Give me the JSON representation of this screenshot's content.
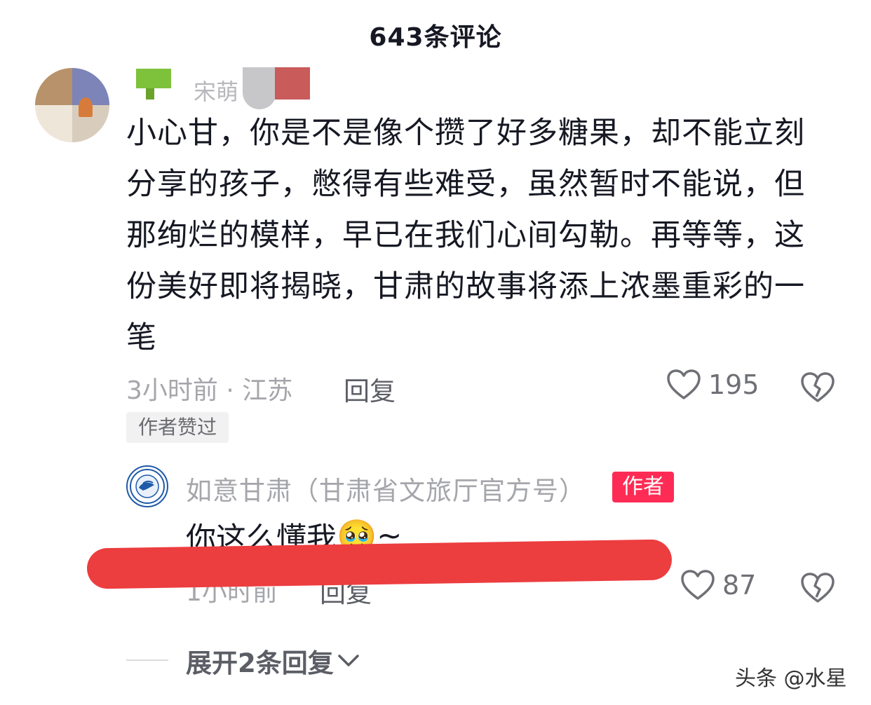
{
  "header": {
    "title": "643条评论"
  },
  "main_comment": {
    "username": "宋萌",
    "lines": [
      "小心甘，你是不是像个攒了好多糖果，却不能立刻",
      "分享的孩子，憋得有些难受，虽然暂时不能说，但",
      "那绚烂的模样，早已在我们心间勾勒。再等等，这",
      "份美好即将揭晓，甘肃的故事将添上浓墨重彩的一",
      "笔"
    ],
    "meta": "3小时前 · 江苏",
    "reply_label": "回复",
    "like_count": "195",
    "liked_by_author": "作者赞过"
  },
  "reply": {
    "username": "如意甘肃（甘肃省文旅厅官方号）",
    "badge": "作者",
    "text": "你这么懂我",
    "emoji": "🥹",
    "suffix": "~",
    "meta": "1小时前",
    "reply_label": "回复",
    "like_count": "87"
  },
  "expand": {
    "label": "展开2条回复"
  },
  "watermark": {
    "text": "头条 @水星"
  },
  "colors": {
    "accent": "#fe2c55",
    "highlight_stroke": "#ec3d3f",
    "text": "#161823",
    "muted": "#a5a6ab"
  }
}
